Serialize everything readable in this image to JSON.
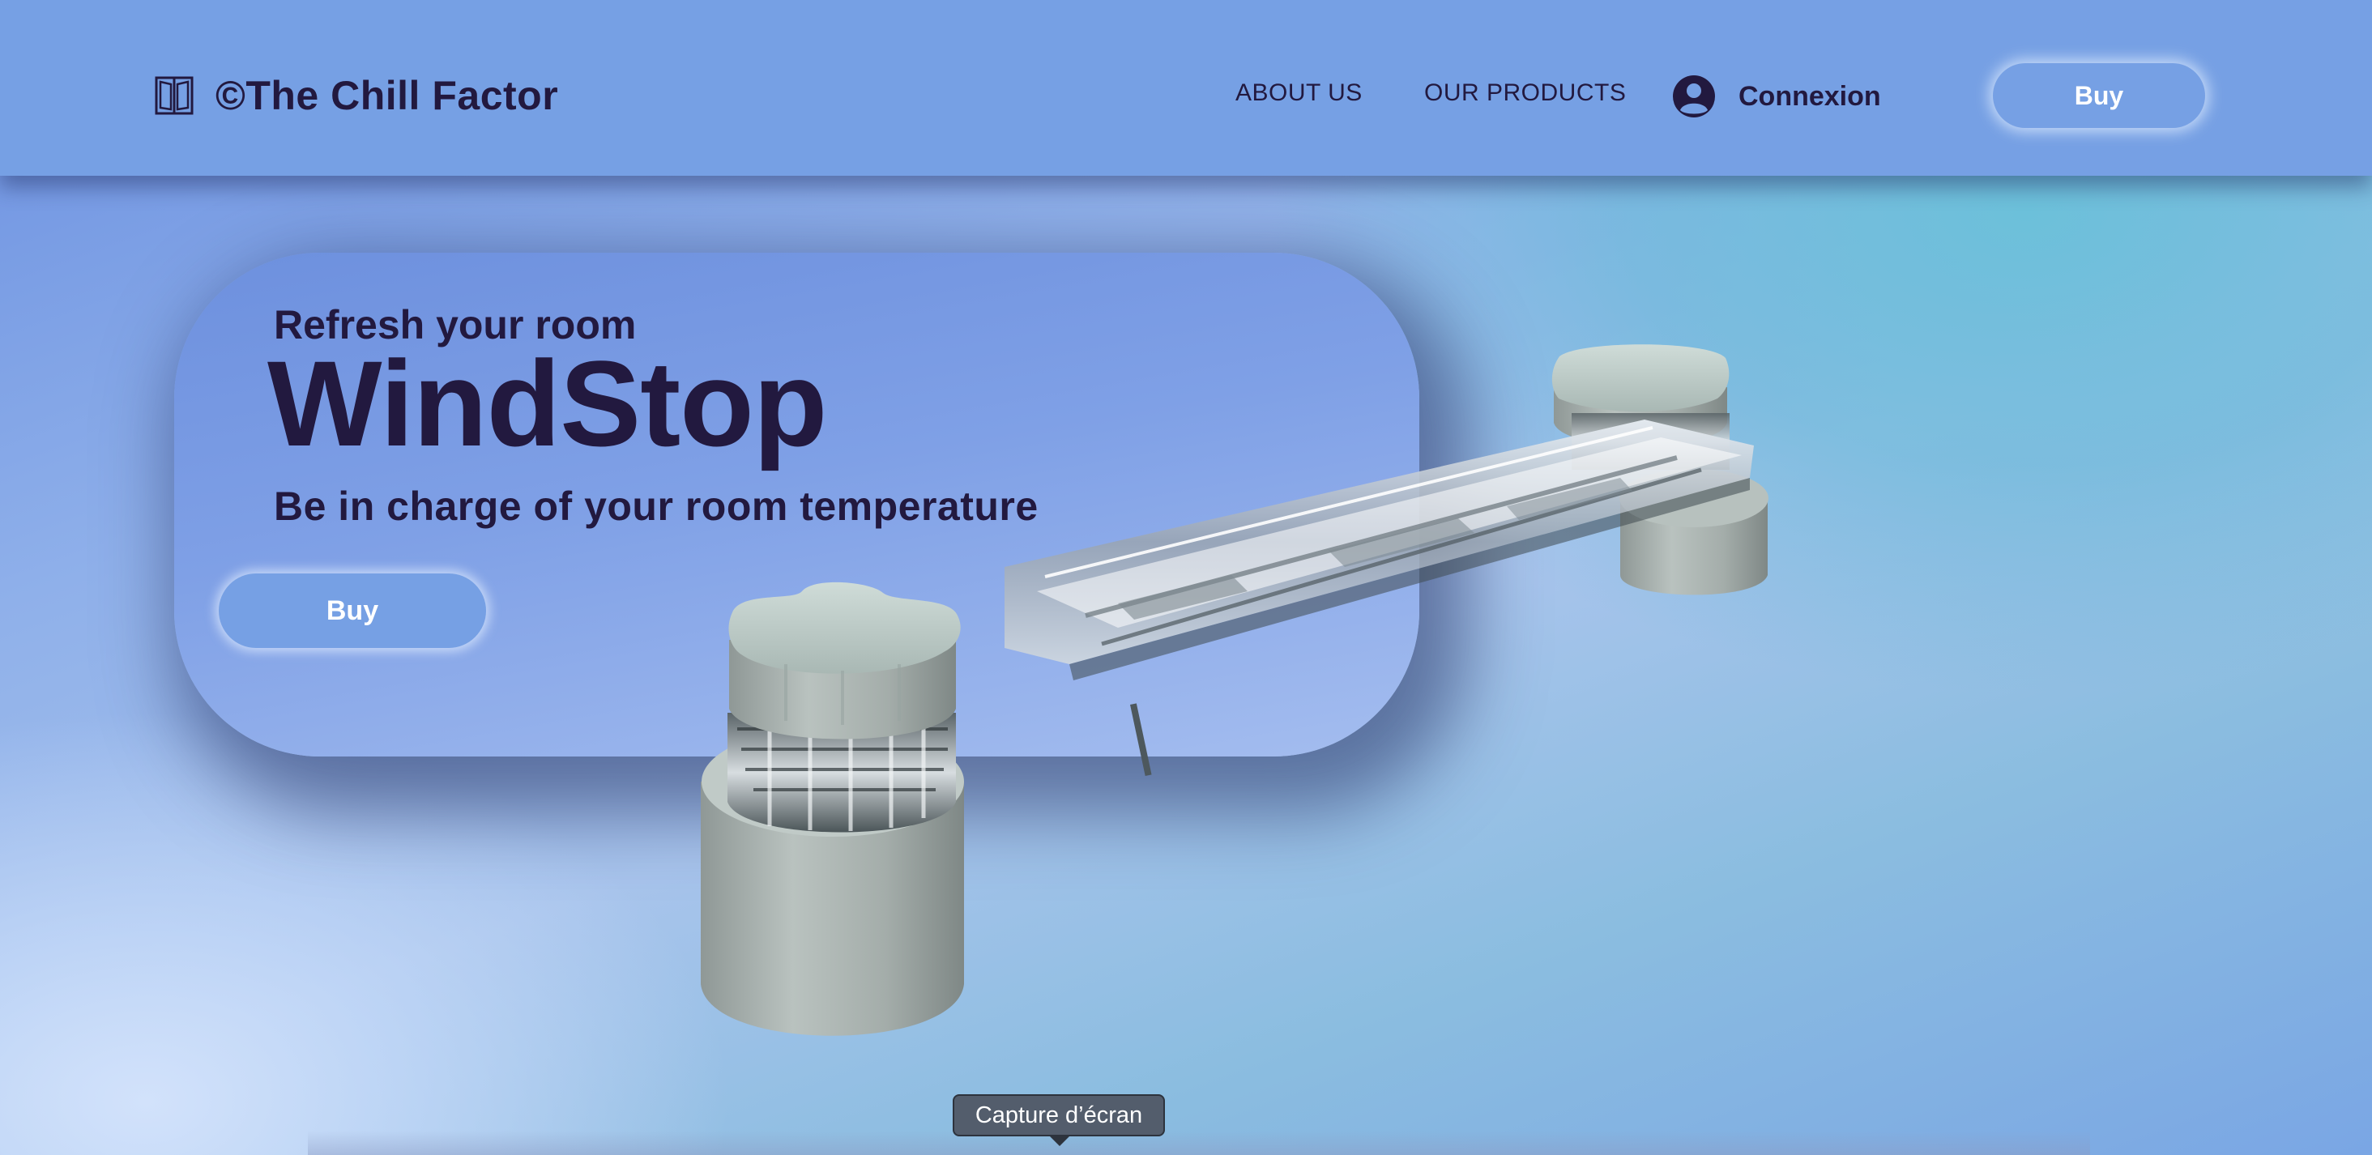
{
  "header": {
    "brand_name": "©The Chill Factor",
    "brand_icon": "window-icon",
    "nav": [
      {
        "label": "ABOUT US"
      },
      {
        "label": "OUR PRODUCTS"
      }
    ],
    "login": {
      "icon": "user-avatar-icon",
      "label": "Connexion"
    },
    "buy_label": "Buy"
  },
  "hero": {
    "eyebrow": "Refresh your room",
    "title": "WindStop",
    "subtitle": "Be in charge of your room temperature",
    "buy_label": "Buy"
  },
  "tooltip": {
    "label": "Capture d’écran"
  },
  "colors": {
    "header_bg": "#76a0e4",
    "text_dark": "#22193f",
    "button_bg": "#76a0e4",
    "button_text": "#ffffff"
  }
}
